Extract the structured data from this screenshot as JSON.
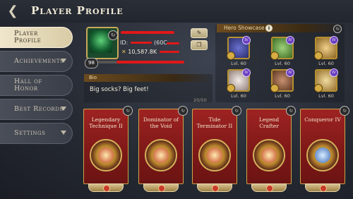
{
  "header": {
    "title": "Player Profile"
  },
  "sidebar": {
    "items": [
      {
        "label": "Player Profile",
        "active": true
      },
      {
        "label": "Achievements",
        "has_dropdown": true
      },
      {
        "label": "Hall of Honor",
        "has_dropdown": false
      },
      {
        "label": "Best Records",
        "has_dropdown": true
      },
      {
        "label": "Settings",
        "has_dropdown": true
      }
    ]
  },
  "profile": {
    "level": "98",
    "id_label": "ID:",
    "id_suffix": "(60C",
    "power": "10,587.8K"
  },
  "bio": {
    "title": "Bio",
    "text": "Big socks? Big feet!",
    "count": "20/50"
  },
  "showcase": {
    "title": "Hero Showcase",
    "heroes": [
      {
        "level": "Lvl. 60",
        "color": "#3b3f9a"
      },
      {
        "level": "Lvl. 60",
        "color": "#5a8a3c"
      },
      {
        "level": "Lvl. 60",
        "color": "#b48b3a"
      },
      {
        "level": "Lvl. 60",
        "color": "#c8b8b0"
      },
      {
        "level": "Lvl. 60",
        "color": "#8a5a3a"
      },
      {
        "level": "Lvl. 60",
        "color": "#c9a05a"
      }
    ]
  },
  "banners": [
    {
      "name": "Legendary Technique II"
    },
    {
      "name": "Dominator of the Void"
    },
    {
      "name": "Tide Terminator II"
    },
    {
      "name": "Legend Crafter"
    },
    {
      "name": "Conqueror IV"
    }
  ],
  "colors": {
    "banner_red": "#9e2322",
    "gold": "#c9a64b",
    "active_tab": "#efe6cc"
  }
}
